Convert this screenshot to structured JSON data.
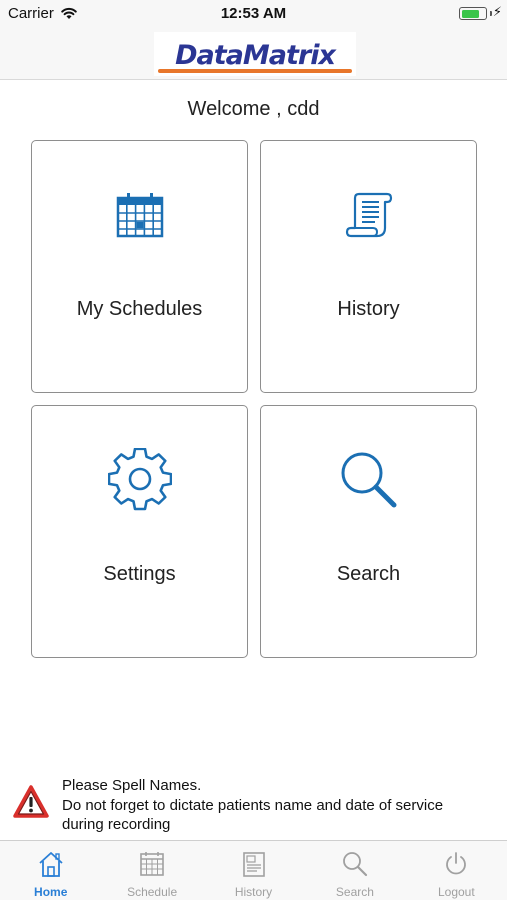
{
  "status_bar": {
    "carrier": "Carrier",
    "time": "12:53 AM",
    "battery_level": 0.8
  },
  "header": {
    "logo_text": "DataMatrix",
    "logo_color": "#2b3694",
    "logo_accent": "#e8762a"
  },
  "welcome_text": "Welcome , cdd",
  "tiles": [
    {
      "label": "My Schedules",
      "icon": "calendar-icon"
    },
    {
      "label": "History",
      "icon": "scroll-icon"
    },
    {
      "label": "Settings",
      "icon": "gear-icon"
    },
    {
      "label": "Search",
      "icon": "magnifier-icon"
    }
  ],
  "notice": {
    "icon": "warning-icon",
    "line1": "Please Spell Names.",
    "line2": "Do not forget to dictate patients name and date of service",
    "line3": "during recording"
  },
  "tab_bar": {
    "active_index": 0,
    "active_color": "#2a7fd6",
    "inactive_color": "#a0a0a0",
    "tabs": [
      {
        "label": "Home",
        "icon": "home-icon"
      },
      {
        "label": "Schedule",
        "icon": "calendar-icon"
      },
      {
        "label": "History",
        "icon": "document-icon"
      },
      {
        "label": "Search",
        "icon": "magnifier-icon"
      },
      {
        "label": "Logout",
        "icon": "power-icon"
      }
    ]
  },
  "colors": {
    "icon_blue": "#1b6fb3",
    "warning_red": "#d9302c"
  }
}
